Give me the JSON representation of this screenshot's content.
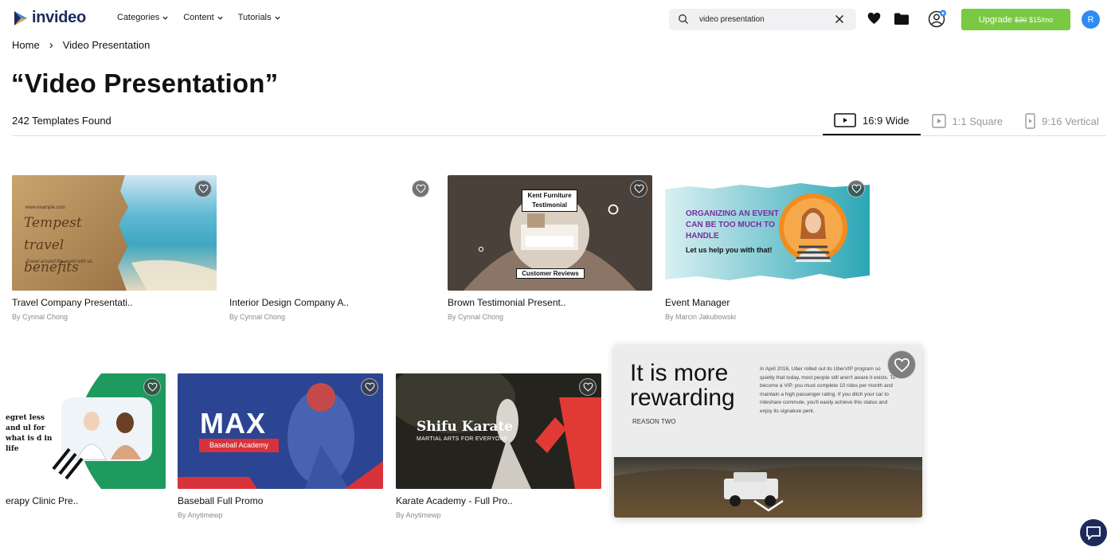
{
  "brand": {
    "name": "invideo"
  },
  "nav": [
    {
      "label": "Categories"
    },
    {
      "label": "Content"
    },
    {
      "label": "Tutorials"
    }
  ],
  "search": {
    "value": "video presentation"
  },
  "upgrade": {
    "label": "Upgrade",
    "old_price": "$30",
    "price": "$15/mo"
  },
  "avatar": {
    "initial": "R"
  },
  "breadcrumb": {
    "home": "Home",
    "separator": "›",
    "current": "Video Presentation"
  },
  "page": {
    "title": "“Video Presentation”",
    "count": "242 Templates Found"
  },
  "ratios": [
    {
      "label": "16:9 Wide",
      "active": true
    },
    {
      "label": "1:1 Square",
      "active": false
    },
    {
      "label": "9:16 Vertical",
      "active": false
    }
  ],
  "cards": [
    {
      "title": "Travel Company Presentati..",
      "author": "By Cynnal Chong",
      "thumb_text": {
        "url": "www.example.com",
        "headline": "Tempest travel benefits",
        "sub": "Travel around the world with us."
      }
    },
    {
      "title": "Interior Design Company A..",
      "author": "By Cynnal Chong"
    },
    {
      "title": "Brown Testimonial Present..",
      "author": "By Cynnal Chong",
      "thumb_text": {
        "top": "Kent Furniture Testimonial",
        "bottom": "Customer Reviews"
      }
    },
    {
      "title": "Event Manager",
      "author": "By Marcin Jakubowski",
      "thumb_text": {
        "headline": "ORGANIZING AN EVENT CAN BE TOO MUCH TO HANDLE",
        "sub": "Let us help you with that!"
      }
    },
    {
      "title": "erapy Clinic Pre..",
      "author": "",
      "thumb_text": {
        "quote": "egret less and ul for what is d in life"
      }
    },
    {
      "title": "Baseball Full Promo",
      "author": "By Anytimewp",
      "thumb_text": {
        "headline": "MAX",
        "sub": "Baseball Academy"
      }
    },
    {
      "title": "Karate Academy - Full Pro..",
      "author": "By Anytimewp",
      "thumb_text": {
        "headline": "Shifu Karate",
        "sub": "MARTIAL ARTS FOR EVERYONE"
      }
    },
    {
      "title": "",
      "author": "",
      "thumb_text": {
        "headline": "It is more rewarding",
        "sub": "REASON TWO",
        "body": "In April 2016, Uber rolled out its UberVIP program so quietly that today, most people still aren't aware it exists. To become a VIP, you must complete 10 rides per month and maintain a high passenger rating. If you ditch your car to rideshare commute, you'll easily achieve this status and enjoy its signature perk."
      }
    }
  ],
  "colors": {
    "accent": "#7ac943",
    "brand": "#1d2b5c",
    "avatar": "#2f8cf0"
  }
}
